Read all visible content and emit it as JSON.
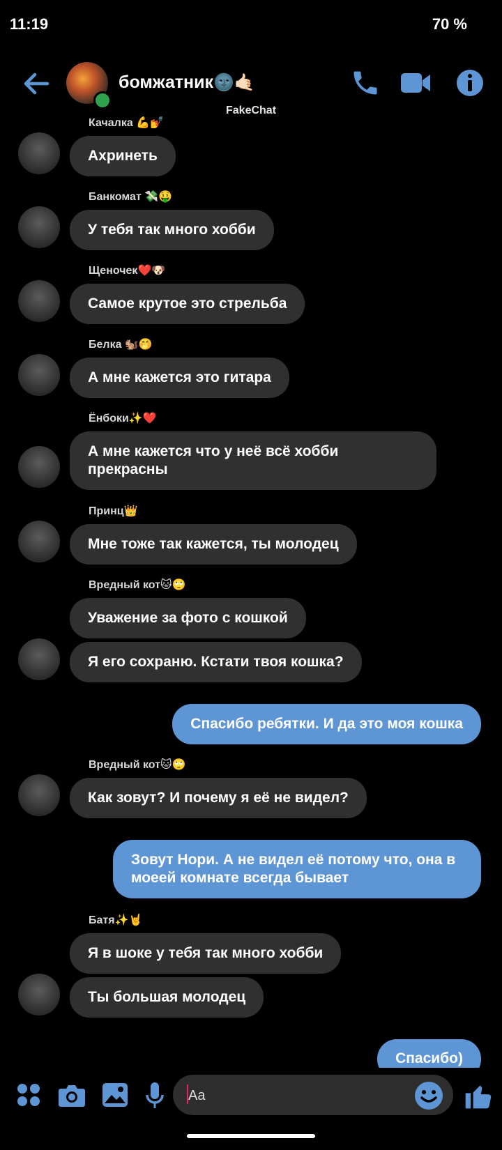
{
  "status_bar": {
    "time": "11:19",
    "battery": "70 %"
  },
  "header": {
    "title": "бомжатник",
    "title_emoji": "🌚🤙🏻",
    "watermark": "FakeChat"
  },
  "colors": {
    "accent": "#5e96d5",
    "incoming_bubble": "#303030",
    "online": "#31a24c",
    "background": "#000000"
  },
  "messages": [
    {
      "sender": "Качалка 💪💅",
      "text": "Ахринеть"
    },
    {
      "sender": "Банкомат 💸🤑",
      "text": "У тебя так много хобби"
    },
    {
      "sender": "Щеночек❤️🐶",
      "text": "Самое крутое это стрельба"
    },
    {
      "sender": "Белка 🐿️🤭",
      "text": "А мне кажется это гитара"
    },
    {
      "sender": "Ёнбоки✨❤️",
      "text": "А мне кажется что у неё всё хобби прекрасны"
    },
    {
      "sender": "Принц👑",
      "text": "Мне тоже так кажется, ты молодец"
    },
    {
      "sender": "Вредный кот🐱🙄",
      "text": "Уважение за фото с кошкой",
      "text2": "Я его сохраню. Кстати твоя кошка?"
    },
    {
      "outgoing": true,
      "text": "Спасибо ребятки. И да это моя кошка"
    },
    {
      "sender": "Вредный кот🐱🙄",
      "text": "Как зовут? И почему я её не видел?"
    },
    {
      "outgoing": true,
      "text": "Зовут Нори. А не видел её потому что, она в моеей комнате всегда бывает"
    },
    {
      "sender": "Батя✨🤘",
      "text": "Я в шоке у тебя так много хобби",
      "text2": "Ты большая молодец"
    },
    {
      "outgoing": true,
      "text": "Спасибо)"
    }
  ],
  "composer": {
    "placeholder": "Aa"
  },
  "icons": [
    "back-arrow-icon",
    "phone-icon",
    "video-camera-icon",
    "info-icon",
    "apps-grid-icon",
    "camera-icon",
    "gallery-icon",
    "microphone-icon",
    "emoji-icon",
    "thumbs-up-icon"
  ]
}
